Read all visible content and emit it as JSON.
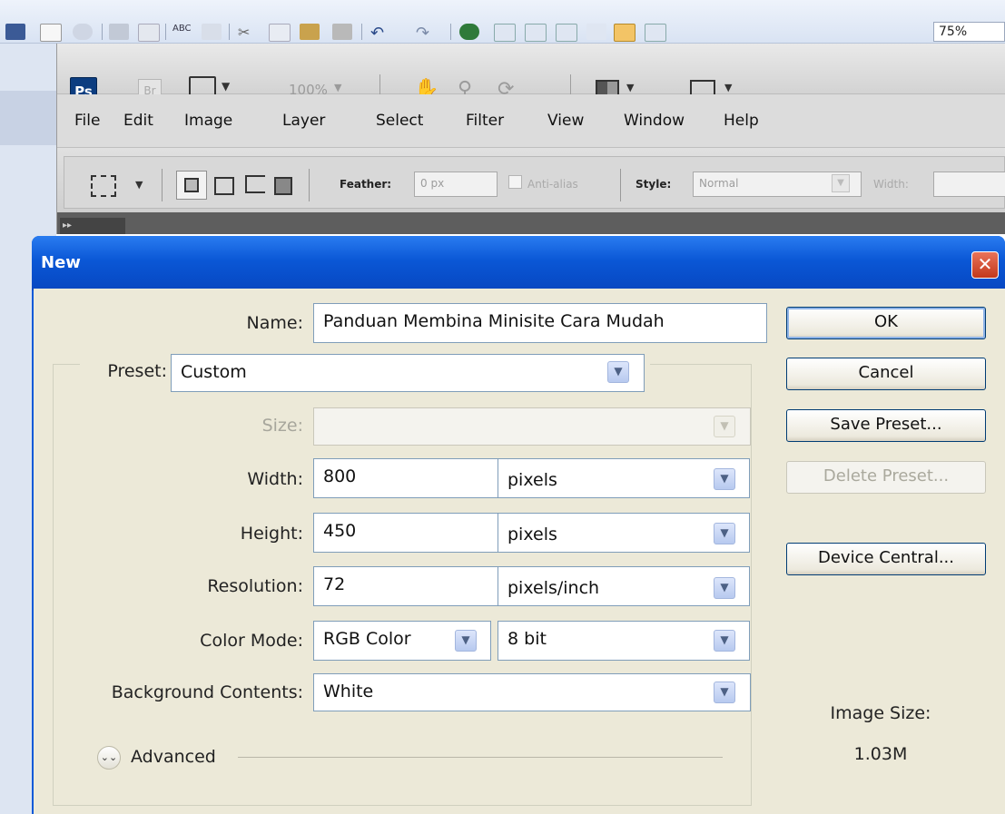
{
  "office_toolbar": {
    "zoom_value": "75%"
  },
  "photoshop": {
    "logo": "Ps",
    "bridge_logo": "Br",
    "zoom_menu": "100%",
    "menu": [
      "File",
      "Edit",
      "Image",
      "Layer",
      "Select",
      "Filter",
      "View",
      "Window",
      "Help"
    ],
    "options": {
      "feather_label": "Feather:",
      "feather_value": "0 px",
      "anti_alias_label": "Anti-alias",
      "style_label": "Style:",
      "style_value": "Normal",
      "width_label": "Width:"
    }
  },
  "dialog": {
    "title": "New",
    "name_label": "Name:",
    "name_value": "Panduan Membina Minisite Cara Mudah",
    "preset_label": "Preset:",
    "preset_value": "Custom",
    "size_label": "Size:",
    "width_label": "Width:",
    "width_value": "800",
    "width_unit": "pixels",
    "height_label": "Height:",
    "height_value": "450",
    "height_unit": "pixels",
    "resolution_label": "Resolution:",
    "resolution_value": "72",
    "resolution_unit": "pixels/inch",
    "color_mode_label": "Color Mode:",
    "color_mode_value": "RGB Color",
    "bit_depth_value": "8 bit",
    "background_label": "Background Contents:",
    "background_value": "White",
    "advanced_label": "Advanced",
    "buttons": {
      "ok": "OK",
      "cancel": "Cancel",
      "save_preset": "Save Preset...",
      "delete_preset": "Delete Preset...",
      "device_central": "Device Central..."
    },
    "image_size_label": "Image Size:",
    "image_size_value": "1.03M"
  },
  "icons": {
    "close": "close-icon",
    "dropdown": "chevron-down-icon",
    "advanced": "double-chevron-down-icon"
  },
  "colors": {
    "title_bar": "#0a57d6",
    "dialog_bg": "#ece9d8",
    "close_button": "#c3381b",
    "ps_logo": "#0c3d80"
  }
}
